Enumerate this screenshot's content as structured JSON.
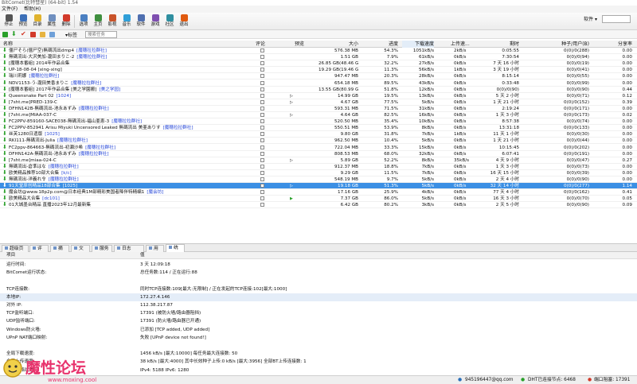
{
  "window": {
    "title": "BitComet(比特彗星) (64-bit) 1.54"
  },
  "menu": [
    "文件(F)",
    "帮助(H)"
  ],
  "toolbar": {
    "buttons": [
      {
        "label": "停止",
        "icon": "stop-icon",
        "color": "#555555"
      },
      {
        "label": "预览",
        "icon": "preview-icon",
        "color": "#3c6fb8"
      },
      {
        "label": "目录",
        "icon": "folder-icon",
        "color": "#e0b32e"
      },
      {
        "label": "属性",
        "icon": "properties-icon",
        "color": "#6f8fbf"
      },
      {
        "label": "删除",
        "icon": "delete-icon",
        "color": "#d23a2a"
      },
      {
        "label": "选项",
        "icon": "options-icon",
        "color": "#4a7fc1"
      },
      {
        "label": "主页",
        "icon": "home-icon",
        "color": "#3f8f3f"
      },
      {
        "label": "影视",
        "icon": "video-icon",
        "color": "#c9532a"
      },
      {
        "label": "音乐",
        "icon": "music-icon",
        "color": "#2f9fd8"
      },
      {
        "label": "软件",
        "icon": "software-icon",
        "color": "#4f6fb0"
      },
      {
        "label": "游戏",
        "icon": "game-icon",
        "color": "#7f4fb0"
      },
      {
        "label": "社区",
        "icon": "community-icon",
        "color": "#2f8fa0"
      },
      {
        "label": "退出",
        "icon": "exit-icon",
        "color": "#e05a10"
      }
    ],
    "skin_label": "软件"
  },
  "subtoolbar": {
    "tags_label": "标签",
    "search_placeholder": "搜索任务"
  },
  "columns": {
    "name": "名称",
    "rating": "评论",
    "preview": "预览",
    "size": "大小",
    "progress": "进度",
    "down": "下载速度",
    "up": "上传速...",
    "eta": "剩时",
    "seeds": "种子/用户(B)",
    "ratio": "分享率"
  },
  "tasks": [
    {
      "name": "僵尸そら(僵尸空)無碼流出dmp4",
      "tag": "[魔穗拉拉群社]",
      "preview": "",
      "size": "576.38 MB",
      "progress": "54.3%",
      "down": "1051kB/s",
      "up": "2kB/s",
      "eta": "0:05:55",
      "seeds": "0(0)/0(288)",
      "ratio": "0.00"
    },
    {
      "name": "無碼流出-大沢美加-瀧田まりこ-2",
      "tag": "[魔穗拉拉群社]",
      "preview": "",
      "size": "1.51 GB",
      "progress": "7.9%",
      "down": "61kB/s",
      "up": "0kB/s",
      "eta": "7:30:54",
      "seeds": "0(0)/0(94)",
      "ratio": "0.00"
    },
    {
      "name": "[魔穗本番組] 2014年作品合集",
      "tag": "",
      "preview": "",
      "size": "26.85 GB(48.46 GB)",
      "progress": "32.2%",
      "down": "27kB/s",
      "up": "0kB/s",
      "eta": "7 天 16 小时",
      "seeds": "0(0)/0(19)",
      "ratio": "0.00"
    },
    {
      "name": "UP-18-08-04 [xing-xing]",
      "tag": "",
      "preview": "",
      "size": "19.29 GB(19.46 GB)",
      "progress": "11.3%",
      "down": "56kB/s",
      "up": "1kB/s",
      "eta": "3 天 19 小时",
      "seeds": "0(0)/0(41)",
      "ratio": "0.00"
    },
    {
      "name": "瑞川莉娜",
      "tag": "[魔穗拉拉群社]",
      "preview": "",
      "size": "947.47 MB",
      "progress": "20.3%",
      "down": "28kB/s",
      "up": "0kB/s",
      "eta": "8:15:14",
      "seeds": "0(0)/0(55)",
      "ratio": "0.00"
    },
    {
      "name": "NDV1153-う-瀧田美香まりこ",
      "tag": "[魔穗拉拉群社]",
      "preview": "",
      "size": "654.18 MB",
      "progress": "89.5%",
      "down": "43kB/s",
      "up": "0kB/s",
      "eta": "0:33:48",
      "seeds": "0(0)/0(99)",
      "ratio": "0.00"
    },
    {
      "name": "[魔穗本番組] 2017年作品合集 [美之学園搬]",
      "tag": "[美之学园]",
      "preview": "",
      "size": "13.55 GB(80.99 GB)",
      "progress": "51.8%",
      "down": "12kB/s",
      "up": "0kB/s",
      "eta": "0(0)/0(90)",
      "seeds": "0(0)/0(90)",
      "ratio": "0.44"
    },
    {
      "name": "Queensnake Part 02",
      "tag": "[1024]",
      "preview": "▷",
      "size": "14.99 GB",
      "progress": "19.5%",
      "down": "13kB/s",
      "up": "0kB/s",
      "eta": "5 天 2 小时",
      "seeds": "0(0)/0(71)",
      "ratio": "0.12"
    },
    {
      "name": "[7sht.me]PRED-139-C",
      "tag": "",
      "preview": "▷",
      "size": "4.67 GB",
      "progress": "77.5%",
      "down": "5kB/s",
      "up": "0kB/s",
      "eta": "1 天 21 小时",
      "seeds": "0(0)/0(152)",
      "ratio": "0.39"
    },
    {
      "name": "DFHN142B-無碼流出-池永あずみ",
      "tag": "[魔穗拉拉群社]",
      "preview": "",
      "size": "593.31 MB",
      "progress": "71.5%",
      "down": "31kB/s",
      "up": "0kB/s",
      "eta": "2:19:24",
      "seeds": "0(0)/0(171)",
      "ratio": "0.00"
    },
    {
      "name": "[7sht.me]MIAA-037-C",
      "tag": "",
      "preview": "▷",
      "size": "4.64 GB",
      "progress": "82.5%",
      "down": "16kB/s",
      "up": "0kB/s",
      "eta": "1 天 3 小时",
      "seeds": "0(0)/0(173)",
      "ratio": "0.02"
    },
    {
      "name": "FC2PPV-859160-SACE038-無碼流出-福山亜恵-3",
      "tag": "[魔穗拉拉群社]",
      "preview": "",
      "size": "520.50 MB",
      "progress": "35.4%",
      "down": "10kB/s",
      "up": "0kB/s",
      "eta": "8:57:38",
      "seeds": "0(0)/0(74)",
      "ratio": "0.00"
    },
    {
      "name": "FC2PPV-852941 Arisu Miyuki Uncensored Leaked 無碼流出 美亜ありす",
      "tag": "[魔穗拉拉群社]",
      "preview": "",
      "size": "550.51 MB",
      "progress": "53.9%",
      "down": "8kB/s",
      "up": "0kB/s",
      "eta": "13:31:18",
      "seeds": "0(0)/0(133)",
      "ratio": "0.00"
    },
    {
      "name": "丝芙1280日遗版",
      "tag": "[1025]",
      "preview": "",
      "size": "9.80 GB",
      "progress": "31.8%",
      "down": "7kB/s",
      "up": "1kB/s",
      "eta": "11 天 1 小时",
      "seeds": "0(0)/0(30)",
      "ratio": "0.00"
    },
    {
      "name": "RKI111-無碼流出-Julia",
      "tag": "[魔穗拉拉群社]",
      "preview": "",
      "size": "962.50 MB",
      "progress": "10.4%",
      "down": "5kB/s",
      "up": "0kB/s",
      "eta": "1 天 21 小时",
      "seeds": "0(0)/0(44)",
      "ratio": "0.00"
    },
    {
      "name": "FC2ppv-864663-無碼流出-初瀬沙希",
      "tag": "[魔穗拉拉群社]",
      "preview": "",
      "size": "722.04 MB",
      "progress": "33.3%",
      "down": "15kB/s",
      "up": "0kB/s",
      "eta": "10:15:45",
      "seeds": "0(0)/0(202)",
      "ratio": "0.00"
    },
    {
      "name": "DFHN142A-無碼流出-池永あずみ",
      "tag": "[魔穗拉拉群社]",
      "preview": "",
      "size": "808.53 MB",
      "progress": "68.0%",
      "down": "32kB/s",
      "up": "0kB/s",
      "eta": "6:07:41",
      "seeds": "0(0)/0(191)",
      "ratio": "0.00"
    },
    {
      "name": "[7sht.me]miaa-024-C",
      "tag": "",
      "preview": "▷",
      "size": "5.89 GB",
      "progress": "52.2%",
      "down": "8kB/s",
      "up": "35kB/s",
      "eta": "4 天 9 小时",
      "seeds": "0(0)/0(47)",
      "ratio": "0.27"
    },
    {
      "name": "無碼流出-倉準はな",
      "tag": "[魔穗拉拉群社]",
      "preview": "",
      "size": "912.37 MB",
      "progress": "18.8%",
      "down": "7kB/s",
      "up": "0kB/s",
      "eta": "1 天 3 小时",
      "seeds": "0(0)/0(73)",
      "ratio": "0.00"
    },
    {
      "name": "欧美精品推荐10部大合集",
      "tag": "[k/c]",
      "preview": "",
      "size": "9.29 GB",
      "progress": "11.5%",
      "down": "7kB/s",
      "up": "0kB/s",
      "eta": "16 天 15 小时",
      "seeds": "0(0)/0(39)",
      "ratio": "0.00"
    },
    {
      "name": "無碼流出-洋義れ令",
      "tag": "[魔穗拉拉群社]",
      "preview": "",
      "size": "548.19 MB",
      "progress": "9.7%",
      "down": "5kB/s",
      "up": "0kB/s",
      "eta": "2 天 4 小时",
      "seeds": "0(0)/0(90)",
      "ratio": "0.00"
    },
    {
      "name": "91天堂原创精品18部合集",
      "tag": "[1025]",
      "preview": "▷",
      "size": "19.18 GB",
      "progress": "51.3%",
      "down": "5kB/s",
      "up": "0kB/s",
      "eta": "32 天 14 小时",
      "seeds": "0(0)/0(277)",
      "ratio": "1.14",
      "selected": true
    },
    {
      "name": "魔会坊@www.18p2p.com@日本经典1M部精彩美国者降伴特精编1",
      "tag": "[魔会坊]",
      "preview": "",
      "size": "17.16 GB",
      "progress": "25.9%",
      "down": "4kB/s",
      "up": "0kB/s",
      "eta": "77 天 4 小时",
      "seeds": "0(0)/0(162)",
      "ratio": "0.41"
    },
    {
      "name": "欧美精品大合集",
      "tag": "[dc101]",
      "preview": "▶",
      "size": "7.37 GB",
      "progress": "86.0%",
      "down": "5kB/s",
      "up": "0kB/s",
      "eta": "16 天 3 小时",
      "seeds": "0(0)/0(70)",
      "ratio": "0.05"
    },
    {
      "name": "01大城墨台精品 直播2023年12月最新集",
      "tag": "",
      "preview": "",
      "size": "6.42 GB",
      "progress": "80.2%",
      "down": "3kB/s",
      "up": "0kB/s",
      "eta": "2 天 5 小时",
      "seeds": "0(0)/0(90)",
      "ratio": "0.09"
    }
  ],
  "detail_tabs": [
    "超级页",
    "评论",
    "摘要",
    "文件",
    "服务器",
    "日志",
    "用户",
    "统计"
  ],
  "detail_active": "统计",
  "detail_header": {
    "key": "项目",
    "value": "值"
  },
  "stats": [
    {
      "k": "运行时间:",
      "v": "3 天 12:09:18"
    },
    {
      "k": "BitComet运行状态:",
      "v": "总任务数:114 / 正在运行:88"
    },
    {
      "k": "",
      "v": ""
    },
    {
      "k": "TCP连接数:",
      "v": "同时TCP连接数:109[最大:无限制] / 正在发起的TCP连接:102[最大:1000]"
    },
    {
      "k": "本地IP:",
      "v": "172.27.4.146",
      "hl": true
    },
    {
      "k": "对外 IP:",
      "v": "112.38.217.87"
    },
    {
      "k": "TCP监听端口:",
      "v": "17391 (被防火墙/路由器阻挡)"
    },
    {
      "k": "UDP监听端口:",
      "v": "17391 (防火墙/路由器已开通)"
    },
    {
      "k": "Windows防火墙:",
      "v": "已添加 [TCP added, UDP added]"
    },
    {
      "k": "UPnP NAT端口映射:",
      "v": "失败 [UPnP device not found!]"
    },
    {
      "k": "",
      "v": ""
    },
    {
      "k": "全局下载速度:",
      "v": "1456 kB/s [最大:10000]     每任务最大连接数: 50"
    },
    {
      "k": "全局上传速度:",
      "v": "38 kB/s [最大:4000]     其中长效种子上传:0 kB/s [最大:3956]     全部BT上传连接数: 1"
    },
    {
      "k": "DHT网络状态:",
      "v": "IPv4: 5188  IPv6: 1280"
    }
  ],
  "status": {
    "qq": "945196447@qq.com",
    "dht": "DHT已连接节点: 6468",
    "port": "端口阻塞: 17391"
  },
  "watermark": {
    "text": "魔性论坛",
    "url": "www.moxing.cool"
  }
}
